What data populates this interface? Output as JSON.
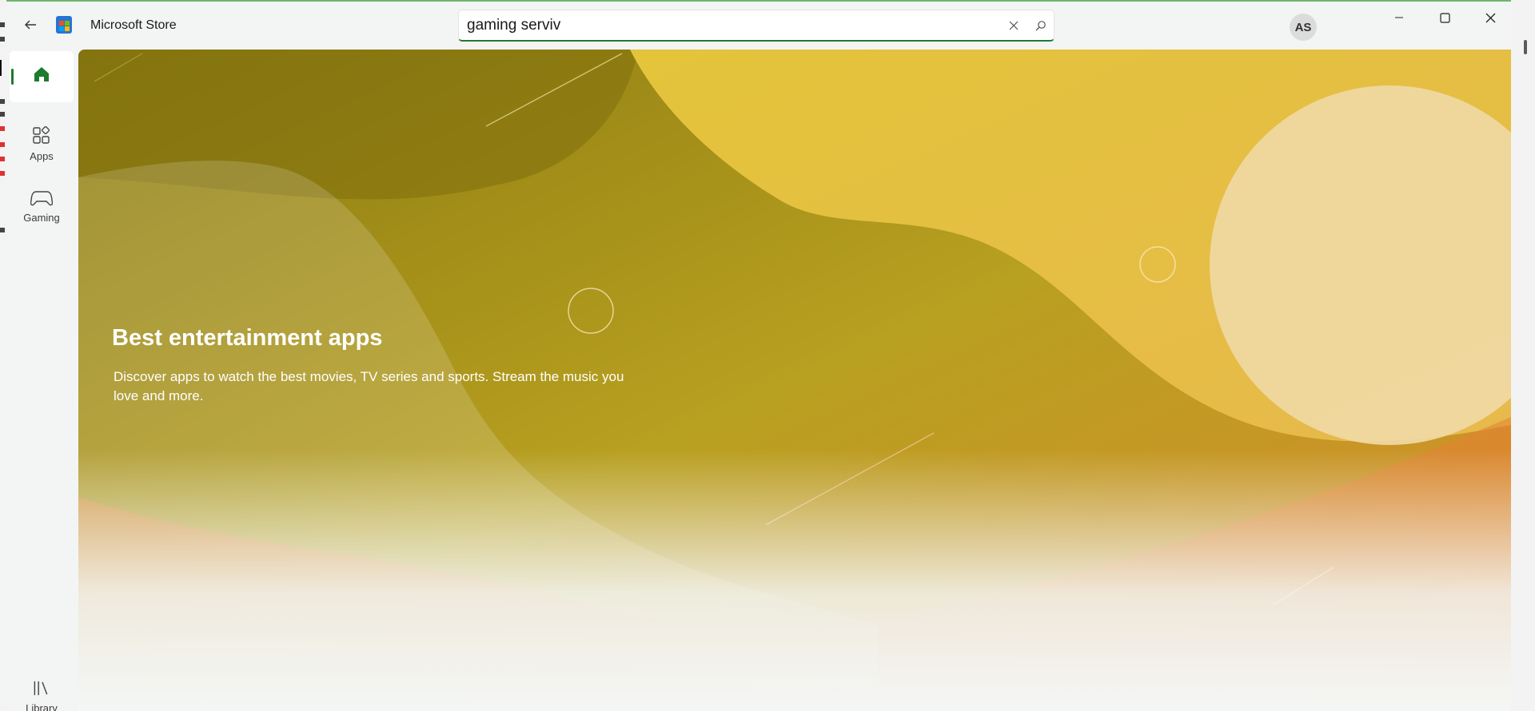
{
  "window": {
    "app_title": "Microsoft Store",
    "accent_color": "#1d7b2e"
  },
  "search": {
    "value": "gaming serviv",
    "clear_icon": "close-icon",
    "submit_icon": "search-icon"
  },
  "account": {
    "initials": "AS"
  },
  "nav": {
    "items": [
      {
        "label": "",
        "icon": "home-icon",
        "selected": true
      },
      {
        "label": "Apps",
        "icon": "apps-icon"
      },
      {
        "label": "Gaming",
        "icon": "gamepad-icon"
      },
      {
        "label": "Library",
        "icon": "library-icon"
      }
    ]
  },
  "hero": {
    "title": "Best entertainment apps",
    "description": "Discover apps to watch the best movies, TV series and sports. Stream the music you love and more."
  }
}
